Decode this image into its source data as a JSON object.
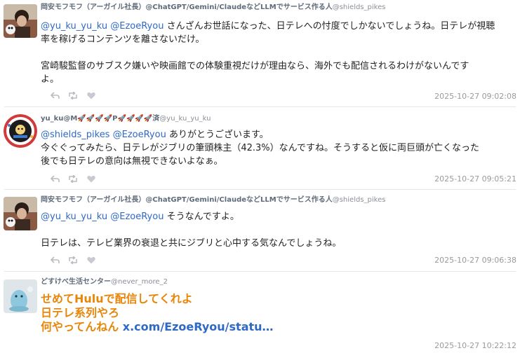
{
  "posts": [
    {
      "author": "岡安モフモフ（アーガイル社長）@ChatGPT/Gemini/ClaudeなどLLMでサービス作る人",
      "handle": "@shields_pikes",
      "mention1": "@yu_ku_yu_ku",
      "mention2": "@EzoeRyou",
      "line1_rest": " さんざんお世話になった、日テレへの忖度でしかないでしょうね。日テレが視聴",
      "line2": "率を稼げるコンテンツを離さないだけ。",
      "line3": "宮崎駿監督のサブスク嫌いや映画館での体験重視だけが理由なら、海外でも配信されるわけがないんです",
      "line4": "よ。",
      "time": "2025-10-27 09:02:08"
    },
    {
      "author": "yu_ku@M🚀🚀🚀🚀P🚀🚀🚀🚀済",
      "handle": "@yu_ku_yu_ku",
      "mention1": "@shields_pikes",
      "mention2": "@EzoeRyou",
      "line1_rest": " ありがとうございます。",
      "line2": "今ぐぐってみたら、日テレがジブリの筆頭株主（42.3%）なんですね。そうすると仮に両巨頭が亡くなった",
      "line3": "後でも日テレの意向は無視できないよなぁ。",
      "time": "2025-10-27 09:05:21"
    },
    {
      "author": "岡安モフモフ（アーガイル社長）@ChatGPT/Gemini/ClaudeなどLLMでサービス作る人",
      "handle": "@shields_pikes",
      "mention1": "@yu_ku_yu_ku",
      "mention2": "@EzoeRyou",
      "line1_rest": " そうなんですよ。",
      "line2": "日テレは、テレビ業界の衰退と共にジブリと心中する気なんでしょうね。",
      "time": "2025-10-27 09:06:38"
    },
    {
      "author": "どすけべ生活センター",
      "handle": "@never_more_2",
      "line1": "せめてHuluで配信してくれよ",
      "line2": "日テレ系列やろ",
      "line3": "何やってんねん",
      "link": "x.com/EzoeRyou/statu…",
      "time": "2025-10-27 10:22:12"
    }
  ],
  "colors": {
    "mention": "#2f69c6",
    "orange_text": "#e8860a",
    "name": "#5f6b7a"
  }
}
